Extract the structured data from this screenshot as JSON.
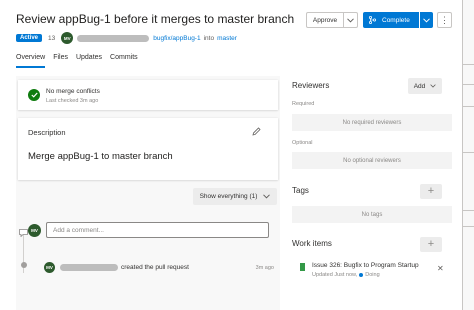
{
  "header": {
    "title": "Review appBug-1 before it merges to master branch",
    "status_badge": "Active",
    "pr_number": "13",
    "author_initials": "MV",
    "source_branch": "bugfix/appBug-1",
    "into_text": "into",
    "target_branch": "master"
  },
  "toolbar": {
    "approve_label": "Approve",
    "complete_label": "Complete",
    "more_label": "⋮"
  },
  "tabs": [
    "Overview",
    "Files",
    "Updates",
    "Commits"
  ],
  "merge_status": {
    "title": "No merge conflicts",
    "subtitle": "Last checked 3m ago"
  },
  "description": {
    "label": "Description",
    "text": "Merge appBug-1 to master branch"
  },
  "filter": {
    "show_label": "Show everything (1)"
  },
  "comment": {
    "avatar_initials": "MV",
    "placeholder": "Add a comment..."
  },
  "activity": {
    "avatar_initials": "MV",
    "action": "created the pull request",
    "time": "3m ago"
  },
  "reviewers": {
    "title": "Reviewers",
    "add_label": "Add",
    "required_label": "Required",
    "required_empty": "No required reviewers",
    "optional_label": "Optional",
    "optional_empty": "No optional reviewers"
  },
  "tags": {
    "title": "Tags",
    "empty": "No tags"
  },
  "work_items": {
    "title": "Work items",
    "item_title": "Issue 326: Bugfix to Program Startup",
    "item_updated": "Updated Just now,",
    "item_state": "Doing"
  },
  "colors": {
    "accent": "#0078d4",
    "success": "#107c10",
    "avatar": "#2d5a2d",
    "work_item_icon": "#339947"
  }
}
